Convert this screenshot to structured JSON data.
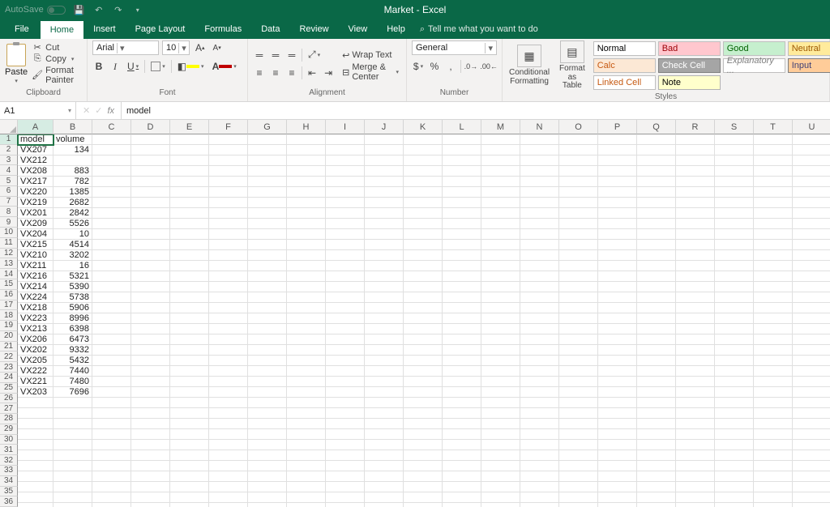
{
  "titlebar": {
    "autosave": "AutoSave",
    "title": "Market - Excel"
  },
  "tabs": [
    "File",
    "Home",
    "Insert",
    "Page Layout",
    "Formulas",
    "Data",
    "Review",
    "View",
    "Help"
  ],
  "tellme_placeholder": "Tell me what you want to do",
  "ribbon": {
    "clipboard": {
      "paste": "Paste",
      "cut": "Cut",
      "copy": "Copy",
      "painter": "Format Painter",
      "label": "Clipboard"
    },
    "font": {
      "name": "Arial",
      "size": "10",
      "label": "Font"
    },
    "alignment": {
      "wrap": "Wrap Text",
      "merge": "Merge & Center",
      "label": "Alignment"
    },
    "number": {
      "format": "General",
      "label": "Number"
    },
    "styles": {
      "cond": "Conditional\nFormatting",
      "table": "Format as\nTable",
      "cells": [
        "Normal",
        "Bad",
        "Good",
        "Neutral",
        "Calc",
        "Check Cell",
        "Explanatory ...",
        "Input",
        "Linked Cell",
        "Note"
      ],
      "label": "Styles"
    }
  },
  "formula_bar": {
    "cell_ref": "A1",
    "fx": "fx",
    "value": "model"
  },
  "columns": [
    "A",
    "B",
    "C",
    "D",
    "E",
    "F",
    "G",
    "H",
    "I",
    "J",
    "K",
    "L",
    "M",
    "N",
    "O",
    "P",
    "Q",
    "R",
    "S",
    "T",
    "U"
  ],
  "rows": 36,
  "data": {
    "headers": [
      "model",
      "volume"
    ],
    "rows": [
      [
        "VX207",
        "134"
      ],
      [
        "VX212",
        ""
      ],
      [
        "VX208",
        "883"
      ],
      [
        "VX217",
        "782"
      ],
      [
        "VX220",
        "1385"
      ],
      [
        "VX219",
        "2682"
      ],
      [
        "VX201",
        "2842"
      ],
      [
        "VX209",
        "5526"
      ],
      [
        "VX204",
        "10"
      ],
      [
        "VX215",
        "4514"
      ],
      [
        "VX210",
        "3202"
      ],
      [
        "VX211",
        "16"
      ],
      [
        "VX216",
        "5321"
      ],
      [
        "VX214",
        "5390"
      ],
      [
        "VX224",
        "5738"
      ],
      [
        "VX218",
        "5906"
      ],
      [
        "VX223",
        "8996"
      ],
      [
        "VX213",
        "6398"
      ],
      [
        "VX206",
        "6473"
      ],
      [
        "VX202",
        "9332"
      ],
      [
        "VX205",
        "5432"
      ],
      [
        "VX222",
        "7440"
      ],
      [
        "VX221",
        "7480"
      ],
      [
        "VX203",
        "7696"
      ]
    ]
  },
  "style_colors": [
    {
      "bg": "#ffffff",
      "fg": "#000",
      "bd": "#bfbfbf"
    },
    {
      "bg": "#ffc7ce",
      "fg": "#9c0006",
      "bd": "#bfbfbf"
    },
    {
      "bg": "#c6efce",
      "fg": "#006100",
      "bd": "#bfbfbf"
    },
    {
      "bg": "#ffeb9c",
      "fg": "#9c5700",
      "bd": "#bfbfbf"
    },
    {
      "bg": "#fce8d5",
      "fg": "#c65911",
      "bd": "#bfbfbf"
    },
    {
      "bg": "#a5a5a5",
      "fg": "#ffffff",
      "bd": "#7f7f7f"
    },
    {
      "bg": "#ffffff",
      "fg": "#7f7f7f",
      "bd": "#bfbfbf",
      "italic": true
    },
    {
      "bg": "#ffcc99",
      "fg": "#3f3f76",
      "bd": "#7f7f7f"
    },
    {
      "bg": "#ffffff",
      "fg": "#c65911",
      "bd": "#bfbfbf"
    },
    {
      "bg": "#ffffcc",
      "fg": "#000",
      "bd": "#b2b2b2"
    }
  ]
}
